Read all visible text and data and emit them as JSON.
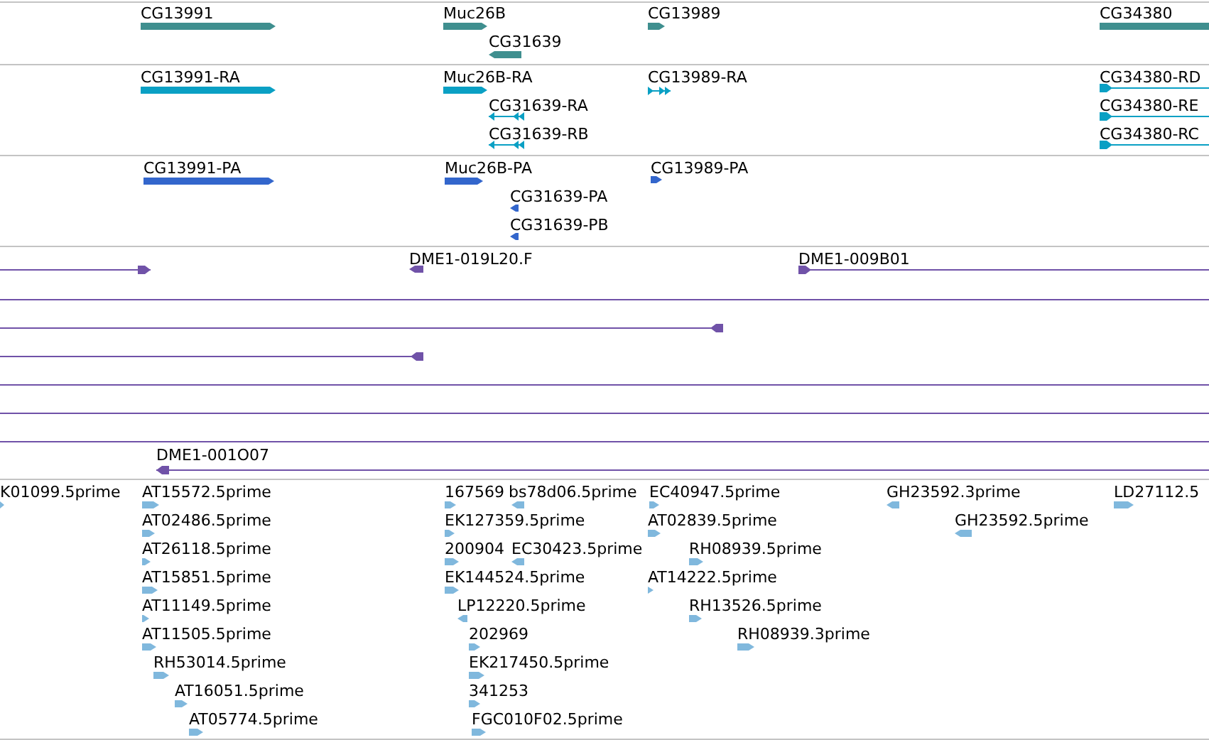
{
  "tracks": [
    {
      "kind": "gene",
      "color": "#3f8f8f",
      "features": [
        {
          "label": "CG13991",
          "kind": "forward"
        },
        {
          "label": "Muc26B",
          "kind": "forward"
        },
        {
          "label": "CG31639",
          "kind": "reverse"
        },
        {
          "label": "CG13989",
          "kind": "forward"
        },
        {
          "label": "CG34380",
          "kind": "forward"
        }
      ]
    },
    {
      "kind": "transcript",
      "color": "#0aa0c4",
      "features": [
        {
          "label": "CG13991-RA",
          "kind": "forward"
        },
        {
          "label": "Muc26B-RA",
          "kind": "forward"
        },
        {
          "label": "CG31639-RA",
          "kind": "reverse"
        },
        {
          "label": "CG31639-RB",
          "kind": "reverse"
        },
        {
          "label": "CG13989-RA",
          "kind": "forward"
        },
        {
          "label": "CG34380-RD",
          "kind": "forward"
        },
        {
          "label": "CG34380-RE",
          "kind": "forward"
        },
        {
          "label": "CG34380-RC",
          "kind": "forward"
        }
      ]
    },
    {
      "kind": "protein",
      "color": "#3366cc",
      "features": [
        {
          "label": "CG13991-PA",
          "kind": "forward"
        },
        {
          "label": "Muc26B-PA",
          "kind": "forward"
        },
        {
          "label": "CG31639-PA",
          "kind": "reverse"
        },
        {
          "label": "CG31639-PB",
          "kind": "reverse"
        },
        {
          "label": "CG13989-PA",
          "kind": "forward"
        }
      ]
    },
    {
      "kind": "clone",
      "color": "#7052a8",
      "features": [
        {
          "kind": "forward"
        },
        {
          "label": "DME1-019L20.F",
          "kind": "reverse"
        },
        {
          "label": "DME1-009B01",
          "kind": "forward"
        },
        {
          "kind": "plain"
        },
        {
          "kind": "reverse"
        },
        {
          "kind": "reverse"
        },
        {
          "kind": "plain"
        },
        {
          "kind": "plain"
        },
        {
          "kind": "plain"
        },
        {
          "label": "DME1-001O07",
          "kind": "reverse"
        }
      ]
    },
    {
      "kind": "est",
      "color": "#80b8dd",
      "features": [
        {
          "label": "K01099.5prime",
          "kind": "forward"
        },
        {
          "label": "AT15572.5prime",
          "kind": "forward"
        },
        {
          "label": "167569",
          "kind": "forward"
        },
        {
          "label": "bs78d06.5prime",
          "kind": "reverse"
        },
        {
          "label": "EC40947.5prime",
          "kind": "forward"
        },
        {
          "label": "GH23592.3prime",
          "kind": "reverse"
        },
        {
          "label": "LD27112.5",
          "kind": "forward"
        },
        {
          "label": "AT02486.5prime",
          "kind": "forward"
        },
        {
          "label": "EK127359.5prime",
          "kind": "forward"
        },
        {
          "label": "AT02839.5prime",
          "kind": "forward"
        },
        {
          "label": "GH23592.5prime",
          "kind": "reverse"
        },
        {
          "label": "AT26118.5prime",
          "kind": "forward"
        },
        {
          "label": "200904",
          "kind": "forward"
        },
        {
          "label": "EC30423.5prime",
          "kind": "reverse"
        },
        {
          "label": "RH08939.5prime",
          "kind": "forward"
        },
        {
          "label": "AT15851.5prime",
          "kind": "forward"
        },
        {
          "label": "EK144524.5prime",
          "kind": "forward"
        },
        {
          "label": "AT14222.5prime",
          "kind": "forward"
        },
        {
          "label": "AT11149.5prime",
          "kind": "forward"
        },
        {
          "label": "LP12220.5prime",
          "kind": "reverse"
        },
        {
          "label": "RH13526.5prime",
          "kind": "forward"
        },
        {
          "label": "AT11505.5prime",
          "kind": "forward"
        },
        {
          "label": "202969",
          "kind": "forward"
        },
        {
          "label": "RH08939.3prime",
          "kind": "forward"
        },
        {
          "label": "RH53014.5prime",
          "kind": "forward"
        },
        {
          "label": "EK217450.5prime",
          "kind": "forward"
        },
        {
          "label": "AT16051.5prime",
          "kind": "forward"
        },
        {
          "label": "341253",
          "kind": "forward"
        },
        {
          "label": "AT05774.5prime",
          "kind": "forward"
        },
        {
          "label": "FGC010F02.5prime",
          "kind": "forward"
        }
      ]
    }
  ]
}
